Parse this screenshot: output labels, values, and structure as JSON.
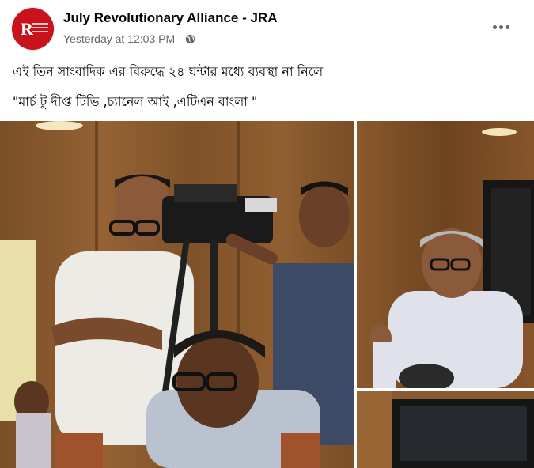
{
  "post": {
    "page_name": "July Revolutionary Alliance - JRA",
    "timestamp": "Yesterday at 12:03 PM",
    "separator": "·",
    "privacy_icon": "globe-icon",
    "more_icon": "more-options-icon",
    "avatar_letter": "R",
    "text_line_1": "এই তিন সাংবাদিক এর বিরুদ্ধে ২৪ ঘন্টার মধ্যে ব্যবস্থা না নিলে",
    "text_line_2": "\"মার্চ টু দীপ্ত টিভি ,চ্যানেল আই ,এটিএন বাংলা \""
  },
  "colors": {
    "avatar_red": "#c8121c",
    "secondary_text": "#65676b",
    "primary_text": "#050505",
    "wood_panel": "#8a5a2e"
  },
  "photos": [
    {
      "name": "photo-journalists-camera"
    },
    {
      "name": "photo-man-speaking"
    },
    {
      "name": "photo-room-screen"
    }
  ]
}
